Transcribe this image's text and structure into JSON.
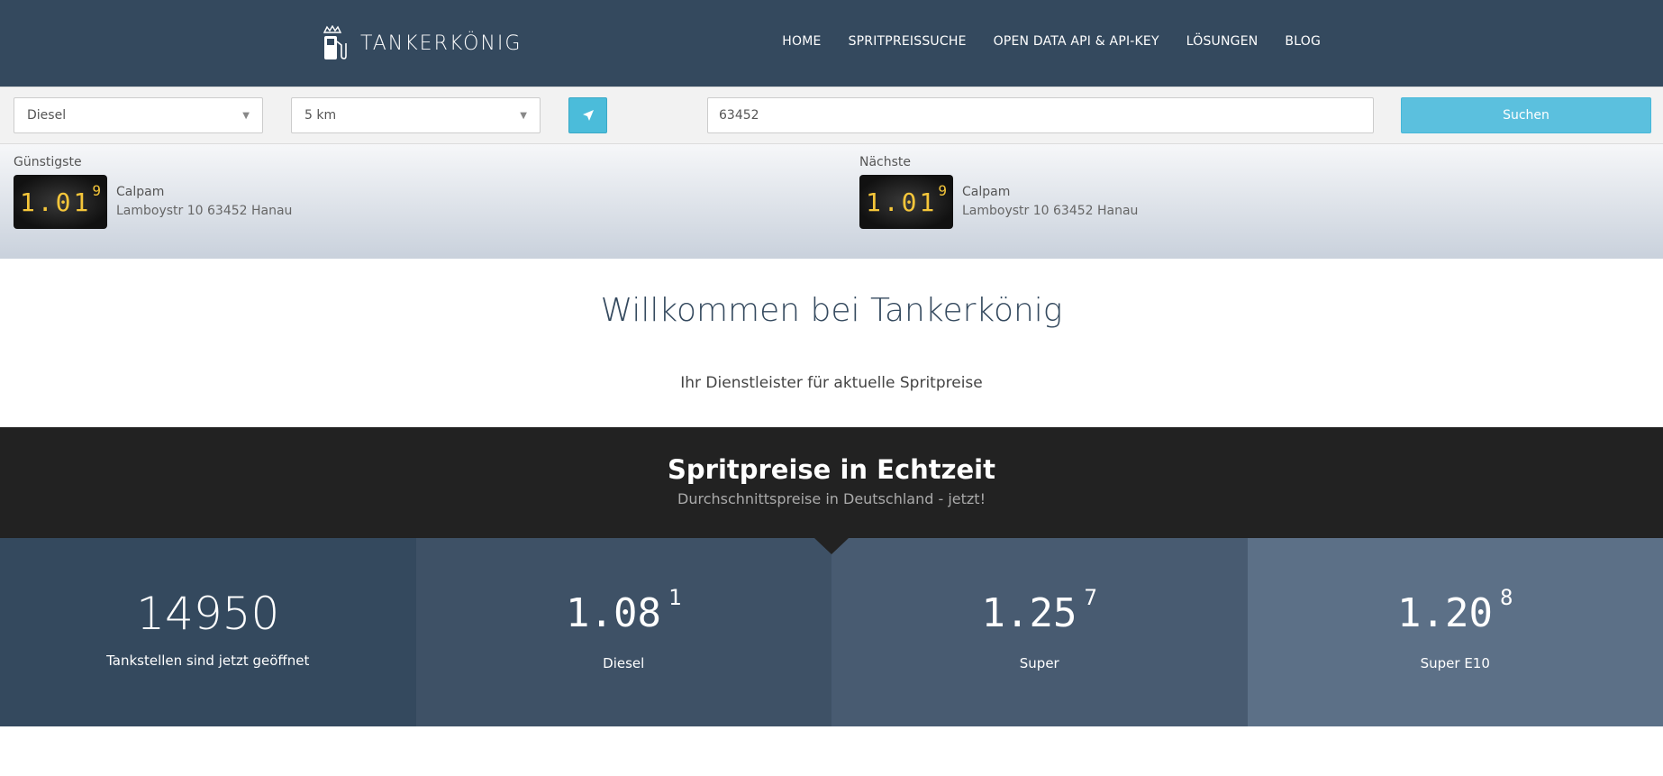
{
  "header": {
    "brand": "TANKERKÖNIG",
    "nav": [
      "HOME",
      "SPRITPREISSUCHE",
      "OPEN DATA API & API-KEY",
      "LÖSUNGEN",
      "BLOG"
    ]
  },
  "search": {
    "fuel_type": "Diesel",
    "radius": "5 km",
    "zip": "63452",
    "submit_label": "Suchen"
  },
  "results": {
    "cheapest": {
      "label": "Günstigste",
      "price_main": "1.01",
      "price_sup": "9",
      "station": "Calpam",
      "address": "Lamboystr 10 63452 Hanau"
    },
    "nearest": {
      "label": "Nächste",
      "price_main": "1.01",
      "price_sup": "9",
      "station": "Calpam",
      "address": "Lamboystr 10 63452 Hanau"
    }
  },
  "welcome": {
    "title": "Willkommen bei Tankerkönig",
    "subtitle": "Ihr Dienstleister für aktuelle Spritpreise"
  },
  "banner": {
    "title": "Spritpreise in Echtzeit",
    "subtitle": "Durchschnittspreise in Deutschland - jetzt!"
  },
  "stats": {
    "open": {
      "value": "14950",
      "label": "Tankstellen sind jetzt geöffnet"
    },
    "diesel": {
      "main": "1.08",
      "sup": "1",
      "label": "Diesel"
    },
    "super": {
      "main": "1.25",
      "sup": "7",
      "label": "Super"
    },
    "e10": {
      "main": "1.20",
      "sup": "8",
      "label": "Super E10"
    }
  },
  "colors": {
    "header_bg": "#34495e",
    "accent": "#5bc0de",
    "digit": "#f5c63a",
    "stat_1": "#34495e",
    "stat_2": "#3e5166",
    "stat_3": "#485b71",
    "stat_4": "#5c7087"
  }
}
